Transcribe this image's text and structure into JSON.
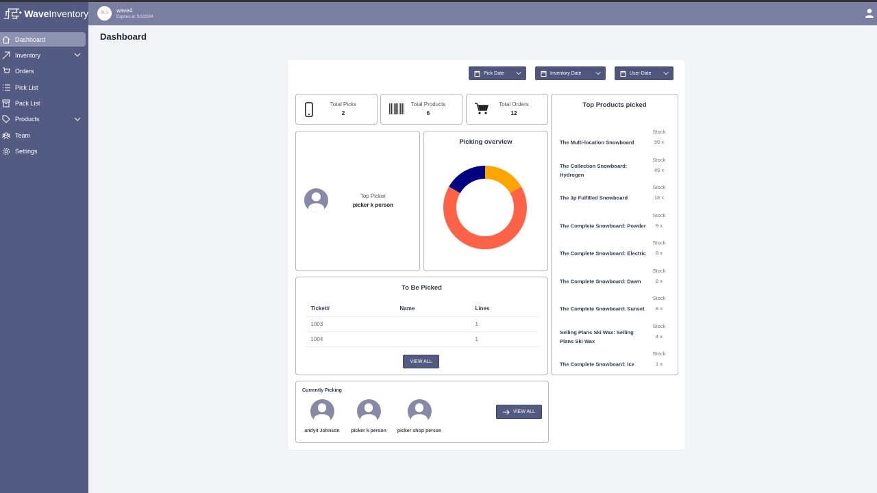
{
  "app": {
    "name_bold": "Wave",
    "name_light": "Inventory"
  },
  "header": {
    "store_name": "wave4",
    "expires": "Expires at: 5/1/2024",
    "store_logo_text": "BLS"
  },
  "sidebar": {
    "items": [
      {
        "label": "Dashboard",
        "icon": "home-icon",
        "active": true
      },
      {
        "label": "Inventory",
        "icon": "arrow-up-right-icon",
        "expandable": true
      },
      {
        "label": "Orders",
        "icon": "cart-icon"
      },
      {
        "label": "Pick List",
        "icon": "list-icon"
      },
      {
        "label": "Pack List",
        "icon": "box-icon"
      },
      {
        "label": "Products",
        "icon": "tag-icon",
        "expandable": true
      },
      {
        "label": "Team",
        "icon": "team-icon"
      },
      {
        "label": "Settings",
        "icon": "gear-icon"
      }
    ]
  },
  "page": {
    "title": "Dashboard"
  },
  "filters": {
    "pick_date": "Pick Date",
    "inventory_date": "Inventory Date",
    "user_date": "User Date"
  },
  "stats": [
    {
      "label": "Total Picks",
      "value": "2",
      "icon": "phone-icon"
    },
    {
      "label": "Total Products",
      "value": "6",
      "icon": "barcode-icon"
    },
    {
      "label": "Total Orders",
      "value": "12",
      "icon": "cart-icon"
    }
  ],
  "top_picker": {
    "label": "Top Picker",
    "name": "picker k person"
  },
  "picking_overview": {
    "title": "Picking overview"
  },
  "chart_data": {
    "type": "pie",
    "donut": true,
    "title": "Picking overview",
    "slices": [
      {
        "fraction": 0.1667,
        "color": "#ffa500"
      },
      {
        "fraction": 0.6667,
        "color": "#ff6347"
      },
      {
        "fraction": 0.1667,
        "color": "#000080"
      }
    ]
  },
  "to_be_picked": {
    "title": "To Be Picked",
    "columns": [
      "Ticket#",
      "Name",
      "Lines"
    ],
    "rows": [
      [
        "1003",
        "",
        "1"
      ],
      [
        "1004",
        "",
        "1"
      ]
    ],
    "view_all": "VIEW ALL"
  },
  "top_products": {
    "title": "Top Products picked",
    "stock_label": "Stock",
    "items": [
      {
        "name": "The Multi-location Snowboard",
        "count": "99 x"
      },
      {
        "name": "The Collection Snowboard: Hydrogen",
        "count": "49 x"
      },
      {
        "name": "The 3p Fulfilled Snowboard",
        "count": "18 x"
      },
      {
        "name": "The Complete Snowboard: Powder",
        "count": "9 x"
      },
      {
        "name": "The Complete Snowboard: Electric",
        "count": "8 x"
      },
      {
        "name": "The Complete Snowboard: Dawn",
        "count": "8 x"
      },
      {
        "name": "The Complete Snowboard: Sunset",
        "count": "8 x"
      },
      {
        "name": "Selling Plans Ski Wax: Selling Plans Ski Wax",
        "count": "4 x"
      },
      {
        "name": "The Complete Snowboard: Ice",
        "count": "1 x"
      }
    ]
  },
  "currently_picking": {
    "title": "Currently Picking",
    "pickers": [
      "andy4 Johnson",
      "picker k person",
      "picker shop person"
    ],
    "view_all": "VIEW ALL"
  }
}
